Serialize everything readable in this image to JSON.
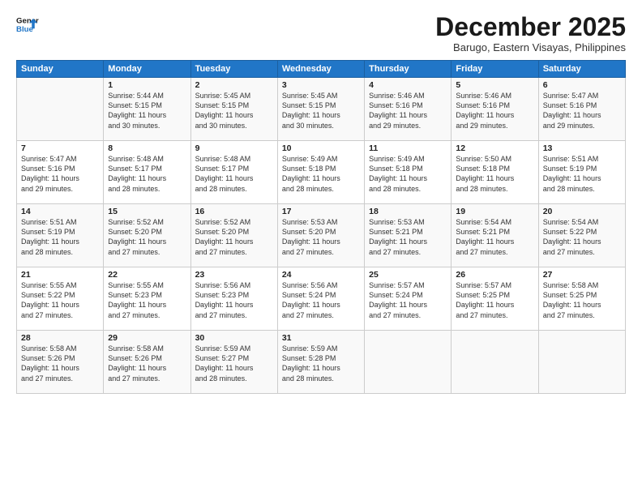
{
  "logo": {
    "line1": "General",
    "line2": "Blue"
  },
  "title": "December 2025",
  "subtitle": "Barugo, Eastern Visayas, Philippines",
  "header_days": [
    "Sunday",
    "Monday",
    "Tuesday",
    "Wednesday",
    "Thursday",
    "Friday",
    "Saturday"
  ],
  "weeks": [
    [
      {
        "day": "",
        "info": ""
      },
      {
        "day": "1",
        "info": "Sunrise: 5:44 AM\nSunset: 5:15 PM\nDaylight: 11 hours\nand 30 minutes."
      },
      {
        "day": "2",
        "info": "Sunrise: 5:45 AM\nSunset: 5:15 PM\nDaylight: 11 hours\nand 30 minutes."
      },
      {
        "day": "3",
        "info": "Sunrise: 5:45 AM\nSunset: 5:15 PM\nDaylight: 11 hours\nand 30 minutes."
      },
      {
        "day": "4",
        "info": "Sunrise: 5:46 AM\nSunset: 5:16 PM\nDaylight: 11 hours\nand 29 minutes."
      },
      {
        "day": "5",
        "info": "Sunrise: 5:46 AM\nSunset: 5:16 PM\nDaylight: 11 hours\nand 29 minutes."
      },
      {
        "day": "6",
        "info": "Sunrise: 5:47 AM\nSunset: 5:16 PM\nDaylight: 11 hours\nand 29 minutes."
      }
    ],
    [
      {
        "day": "7",
        "info": "Sunrise: 5:47 AM\nSunset: 5:16 PM\nDaylight: 11 hours\nand 29 minutes."
      },
      {
        "day": "8",
        "info": "Sunrise: 5:48 AM\nSunset: 5:17 PM\nDaylight: 11 hours\nand 28 minutes."
      },
      {
        "day": "9",
        "info": "Sunrise: 5:48 AM\nSunset: 5:17 PM\nDaylight: 11 hours\nand 28 minutes."
      },
      {
        "day": "10",
        "info": "Sunrise: 5:49 AM\nSunset: 5:18 PM\nDaylight: 11 hours\nand 28 minutes."
      },
      {
        "day": "11",
        "info": "Sunrise: 5:49 AM\nSunset: 5:18 PM\nDaylight: 11 hours\nand 28 minutes."
      },
      {
        "day": "12",
        "info": "Sunrise: 5:50 AM\nSunset: 5:18 PM\nDaylight: 11 hours\nand 28 minutes."
      },
      {
        "day": "13",
        "info": "Sunrise: 5:51 AM\nSunset: 5:19 PM\nDaylight: 11 hours\nand 28 minutes."
      }
    ],
    [
      {
        "day": "14",
        "info": "Sunrise: 5:51 AM\nSunset: 5:19 PM\nDaylight: 11 hours\nand 28 minutes."
      },
      {
        "day": "15",
        "info": "Sunrise: 5:52 AM\nSunset: 5:20 PM\nDaylight: 11 hours\nand 27 minutes."
      },
      {
        "day": "16",
        "info": "Sunrise: 5:52 AM\nSunset: 5:20 PM\nDaylight: 11 hours\nand 27 minutes."
      },
      {
        "day": "17",
        "info": "Sunrise: 5:53 AM\nSunset: 5:20 PM\nDaylight: 11 hours\nand 27 minutes."
      },
      {
        "day": "18",
        "info": "Sunrise: 5:53 AM\nSunset: 5:21 PM\nDaylight: 11 hours\nand 27 minutes."
      },
      {
        "day": "19",
        "info": "Sunrise: 5:54 AM\nSunset: 5:21 PM\nDaylight: 11 hours\nand 27 minutes."
      },
      {
        "day": "20",
        "info": "Sunrise: 5:54 AM\nSunset: 5:22 PM\nDaylight: 11 hours\nand 27 minutes."
      }
    ],
    [
      {
        "day": "21",
        "info": "Sunrise: 5:55 AM\nSunset: 5:22 PM\nDaylight: 11 hours\nand 27 minutes."
      },
      {
        "day": "22",
        "info": "Sunrise: 5:55 AM\nSunset: 5:23 PM\nDaylight: 11 hours\nand 27 minutes."
      },
      {
        "day": "23",
        "info": "Sunrise: 5:56 AM\nSunset: 5:23 PM\nDaylight: 11 hours\nand 27 minutes."
      },
      {
        "day": "24",
        "info": "Sunrise: 5:56 AM\nSunset: 5:24 PM\nDaylight: 11 hours\nand 27 minutes."
      },
      {
        "day": "25",
        "info": "Sunrise: 5:57 AM\nSunset: 5:24 PM\nDaylight: 11 hours\nand 27 minutes."
      },
      {
        "day": "26",
        "info": "Sunrise: 5:57 AM\nSunset: 5:25 PM\nDaylight: 11 hours\nand 27 minutes."
      },
      {
        "day": "27",
        "info": "Sunrise: 5:58 AM\nSunset: 5:25 PM\nDaylight: 11 hours\nand 27 minutes."
      }
    ],
    [
      {
        "day": "28",
        "info": "Sunrise: 5:58 AM\nSunset: 5:26 PM\nDaylight: 11 hours\nand 27 minutes."
      },
      {
        "day": "29",
        "info": "Sunrise: 5:58 AM\nSunset: 5:26 PM\nDaylight: 11 hours\nand 27 minutes."
      },
      {
        "day": "30",
        "info": "Sunrise: 5:59 AM\nSunset: 5:27 PM\nDaylight: 11 hours\nand 28 minutes."
      },
      {
        "day": "31",
        "info": "Sunrise: 5:59 AM\nSunset: 5:28 PM\nDaylight: 11 hours\nand 28 minutes."
      },
      {
        "day": "",
        "info": ""
      },
      {
        "day": "",
        "info": ""
      },
      {
        "day": "",
        "info": ""
      }
    ]
  ]
}
